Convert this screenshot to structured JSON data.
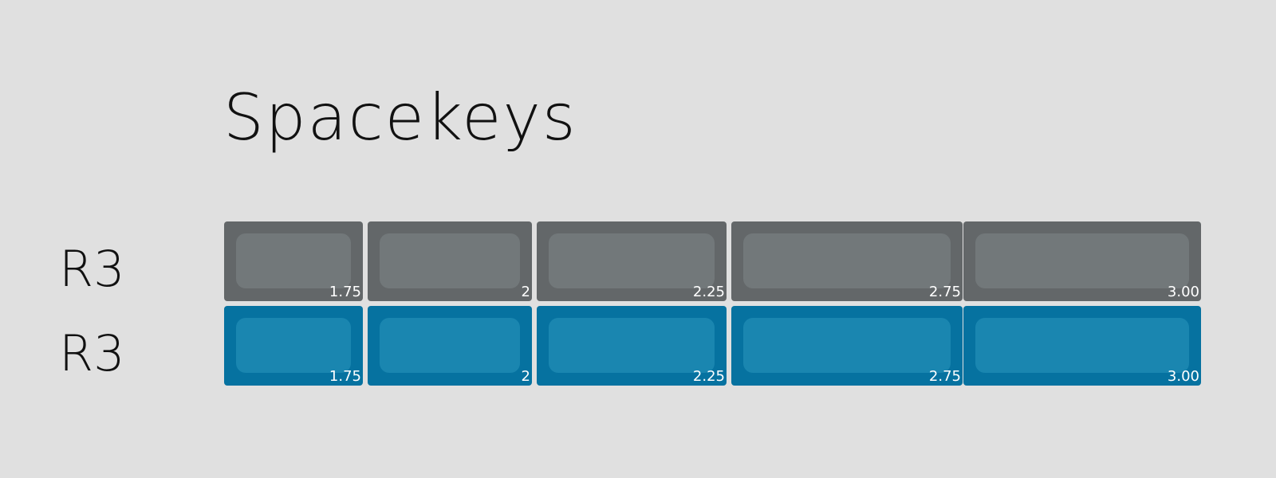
{
  "title": "Spacekeys",
  "rows": [
    {
      "label": "R3",
      "base_color": "#636769",
      "cap_color": "#72787a",
      "keys": [
        "1.75",
        "2",
        "2.25",
        "2.75",
        "3.00"
      ]
    },
    {
      "label": "R3",
      "base_color": "#0672a0",
      "cap_color": "#1a86b0",
      "keys": [
        "1.75",
        "2",
        "2.25",
        "2.75",
        "3.00"
      ]
    }
  ]
}
